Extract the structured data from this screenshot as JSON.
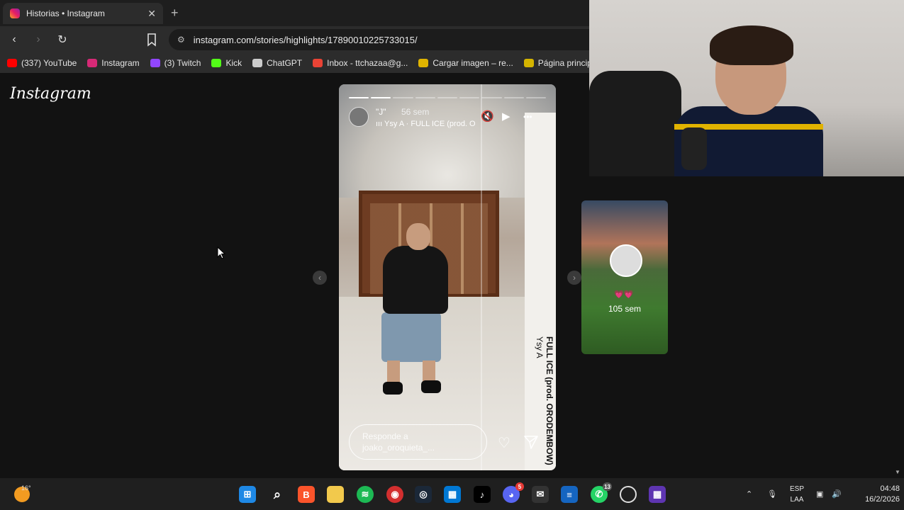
{
  "browser": {
    "tab_title": "Historias • Instagram",
    "tab_close": "✕",
    "new_tab": "+",
    "url": "instagram.com/stories/highlights/17890010225733015/",
    "back_icon": "‹",
    "forward_icon": "›",
    "reload_icon": "↻"
  },
  "bookmarks": [
    {
      "label": "(337) YouTube",
      "color": "#ff0000",
      "icon": "youtube-icon"
    },
    {
      "label": "Instagram",
      "color": "#d62976",
      "icon": "instagram-icon"
    },
    {
      "label": "(3) Twitch",
      "color": "#9146ff",
      "icon": "twitch-icon"
    },
    {
      "label": "Kick",
      "color": "#53fc18",
      "icon": "kick-icon"
    },
    {
      "label": "ChatGPT",
      "color": "#cccccc",
      "icon": "chatgpt-icon"
    },
    {
      "label": "Inbox - ttchazaa@g...",
      "color": "#ea4335",
      "icon": "gmail-icon"
    },
    {
      "label": "Cargar imagen – re...",
      "color": "#e0b400",
      "icon": "image-upload-icon"
    },
    {
      "label": "Página principal",
      "color": "#d4b400",
      "icon": "home-page-icon"
    }
  ],
  "page": {
    "logo": "Instagram"
  },
  "story": {
    "username": "\"J\"",
    "time": "56 sem",
    "music": "Ysy A · FULL ICE (prod. O",
    "progress_segments": 9,
    "progress_done": 2,
    "overlay_title": "FULL ICE (prod. ORODEMBOW)",
    "overlay_artist": "Ysy A",
    "reply_placeholder": "Responde a joako_oroquieta_...",
    "mute_icon": "🔇",
    "play_icon": "▶",
    "more_icon": "•••",
    "heart_icon": "♡",
    "prev_icon": "‹",
    "next_icon": "›"
  },
  "next_story": {
    "hearts": "💗💗",
    "time": "105 sem"
  },
  "taskbar": {
    "temperature": "16°",
    "language_line1": "ESP",
    "language_line2": "LAA",
    "time": "04:48",
    "date": "16/2/2026",
    "discord_badge": "5",
    "whatsapp_badge": "13"
  }
}
